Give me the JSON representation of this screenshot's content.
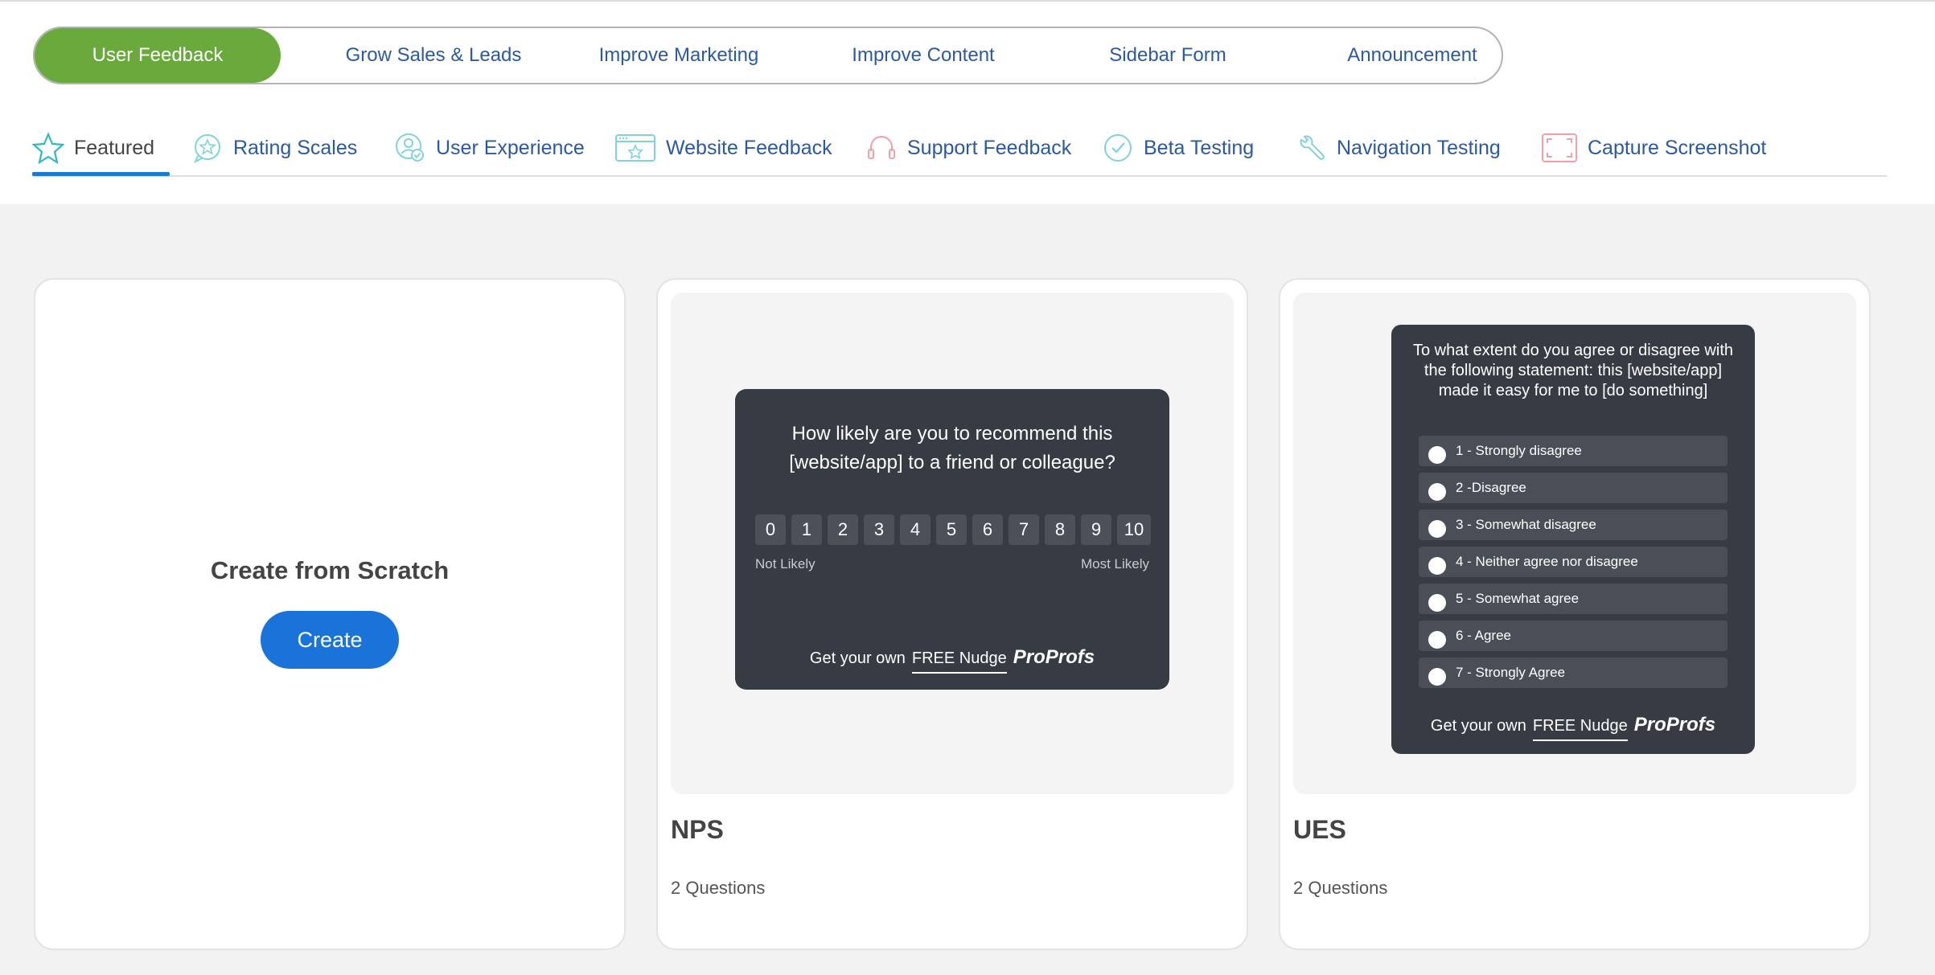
{
  "categories": [
    {
      "label": "User Feedback",
      "active": true
    },
    {
      "label": "Grow Sales & Leads"
    },
    {
      "label": "Improve Marketing"
    },
    {
      "label": "Improve Content"
    },
    {
      "label": "Sidebar Form"
    },
    {
      "label": "Announcement"
    }
  ],
  "subtabs": [
    {
      "label": "Featured",
      "icon": "star-icon",
      "active": true
    },
    {
      "label": "Rating Scales",
      "icon": "rating-bubble-icon"
    },
    {
      "label": "User Experience",
      "icon": "user-check-icon"
    },
    {
      "label": "Website Feedback",
      "icon": "browser-star-icon"
    },
    {
      "label": "Support Feedback",
      "icon": "headset-icon"
    },
    {
      "label": "Beta Testing",
      "icon": "check-circle-icon"
    },
    {
      "label": "Navigation Testing",
      "icon": "wrench-icon"
    },
    {
      "label": "Capture Screenshot",
      "icon": "screenshot-frame-icon"
    }
  ],
  "scratch": {
    "title": "Create from Scratch",
    "button": "Create"
  },
  "nps": {
    "question": "How likely are you to recommend this [website/app] to a friend or colleague?",
    "scale": [
      "0",
      "1",
      "2",
      "3",
      "4",
      "5",
      "6",
      "7",
      "8",
      "9",
      "10"
    ],
    "low_label": "Not Likely",
    "high_label": "Most Likely",
    "title": "NPS",
    "count": "2 Questions"
  },
  "ues": {
    "question": "To what extent do you agree or disagree with the following statement: this [website/app] made it easy for me to [do something]",
    "options": [
      "1 - Strongly disagree",
      "2 -Disagree",
      "3 - Somewhat disagree",
      "4 - Neither agree nor disagree",
      "5 - Somewhat agree",
      "6 - Agree",
      "7 - Strongly Agree"
    ],
    "title": "UES",
    "count": "2 Questions"
  },
  "footer": {
    "prefix": "Get your own",
    "link": "FREE Nudge",
    "brand": "ProProfs"
  },
  "colors": {
    "accent_green": "#6aaa3d",
    "accent_blue": "#1a73d8",
    "link_blue": "#2b5aa0",
    "widget_dark": "#373b43"
  }
}
